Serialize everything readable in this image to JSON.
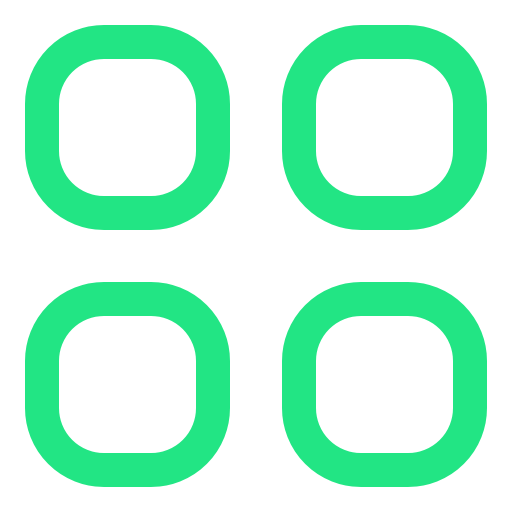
{
  "icon": {
    "name": "app-grid-icon",
    "color": "#22E584",
    "tiles": [
      {
        "name": "grid-tile-top-left-icon"
      },
      {
        "name": "grid-tile-top-right-icon"
      },
      {
        "name": "grid-tile-bottom-left-icon"
      },
      {
        "name": "grid-tile-bottom-right-icon"
      }
    ]
  }
}
